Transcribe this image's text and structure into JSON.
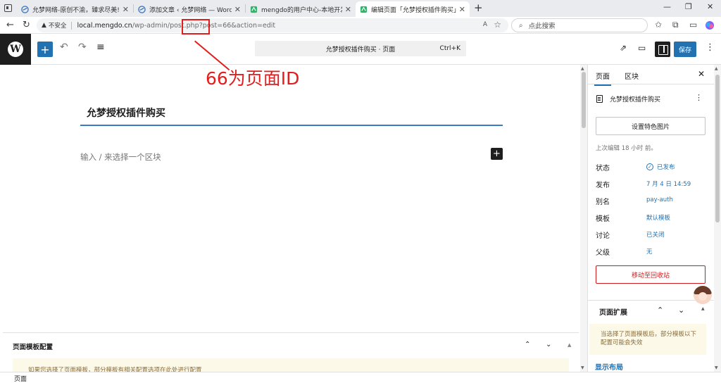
{
  "browser": {
    "tabs": [
      {
        "title": "允梦网络-原创不渝，臻求尽美!",
        "close": "✕"
      },
      {
        "title": "添加文章 ‹ 允梦网络 — WordPress",
        "close": "✕"
      },
      {
        "title": "mengdo的用户中心-本地开发",
        "close": "✕"
      },
      {
        "title": "编辑页面「允梦授权插件购买」",
        "close": "✕"
      }
    ],
    "new_tab": "+",
    "window_controls": {
      "minimize": "—",
      "maximize": "❐",
      "close": "✕"
    },
    "address": {
      "warning": "▲",
      "insecure": "不安全",
      "host": "local.mengdo.cn",
      "path": "/wp-admin/post.php?post=66&action=edit",
      "read_aloud": "A",
      "favorite": "☆"
    },
    "search_placeholder": "点此搜索"
  },
  "editor": {
    "command_bar": "允梦授权插件购买 · 页面",
    "shortcut": "Ctrl+K",
    "save": "保存",
    "post_title": "允梦授权插件购买",
    "block_placeholder": "输入 / 来选择一个区块",
    "annotation": "66为页面ID"
  },
  "meta_panel": {
    "title": "页面模板配置",
    "notice": "如果您选择了页面模板，部分模板有相关配置选项在此处进行配置"
  },
  "statusbar": {
    "label": "页面"
  },
  "sidebar": {
    "tabs": [
      "页面",
      "区块"
    ],
    "doc_title": "允梦授权插件购买",
    "featured_image": "设置特色图片",
    "last_edited": "上次编辑 18 小时 前。",
    "properties": [
      {
        "label": "状态",
        "value": "已发布"
      },
      {
        "label": "发布",
        "value": "7 月 4 日 14:59"
      },
      {
        "label": "别名",
        "value": "pay-auth"
      },
      {
        "label": "模板",
        "value": "默认模板"
      },
      {
        "label": "讨论",
        "value": "已关闭"
      },
      {
        "label": "父级",
        "value": "无"
      }
    ],
    "trash": "移动至回收站",
    "extension_title": "页面扩展",
    "extension_notice": "当选择了页面模板后，部分模板以下配置可能会失效",
    "layout_title": "显示布局"
  }
}
